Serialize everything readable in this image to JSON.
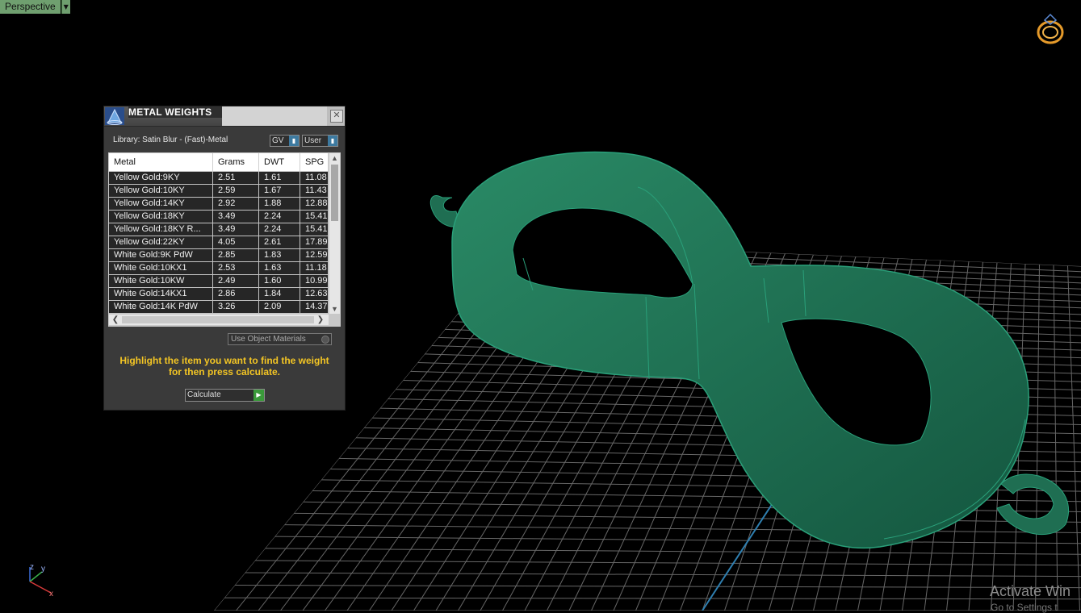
{
  "viewport": {
    "label": "Perspective",
    "dropdown_icon": "triangle-down-icon"
  },
  "colors": {
    "model": "#1f6e52",
    "model_edge": "#2aa07a",
    "grid": "#8a8a8a",
    "hint": "#f3c524",
    "viewport_label_bg": "#6f9f6f"
  },
  "panel": {
    "title": "METAL WEIGHTS",
    "close_label": "✕",
    "library": "Library: Satin Blur - (Fast)-Metal",
    "unit_select": "GV",
    "source_select": "User",
    "columns": [
      "Metal",
      "Grams",
      "DWT",
      "SPG"
    ],
    "rows": [
      [
        "Yellow Gold:9KY",
        "2.51",
        "1.61",
        "11.08"
      ],
      [
        "Yellow Gold:10KY",
        "2.59",
        "1.67",
        "11.43"
      ],
      [
        "Yellow Gold:14KY",
        "2.92",
        "1.88",
        "12.88"
      ],
      [
        "Yellow Gold:18KY",
        "3.49",
        "2.24",
        "15.41"
      ],
      [
        "Yellow Gold:18KY R...",
        "3.49",
        "2.24",
        "15.41"
      ],
      [
        "Yellow Gold:22KY",
        "4.05",
        "2.61",
        "17.89"
      ],
      [
        "White Gold:9K PdW",
        "2.85",
        "1.83",
        "12.59"
      ],
      [
        "White Gold:10KX1",
        "2.53",
        "1.63",
        "11.18"
      ],
      [
        "White Gold:10KW",
        "2.49",
        "1.60",
        "10.99"
      ],
      [
        "White Gold:14KX1",
        "2.86",
        "1.84",
        "12.63"
      ],
      [
        "White Gold:14K PdW",
        "3.26",
        "2.09",
        "14.37"
      ]
    ],
    "use_object_materials": "Use Object Materials",
    "hint": "Highlight the item you want to find the weight for then press calculate.",
    "calculate_label": "Calculate"
  },
  "axis": {
    "z": "z",
    "y": "y",
    "x": "x"
  },
  "watermark": {
    "line1": "Activate Win",
    "line2": "Go to Settings t"
  }
}
